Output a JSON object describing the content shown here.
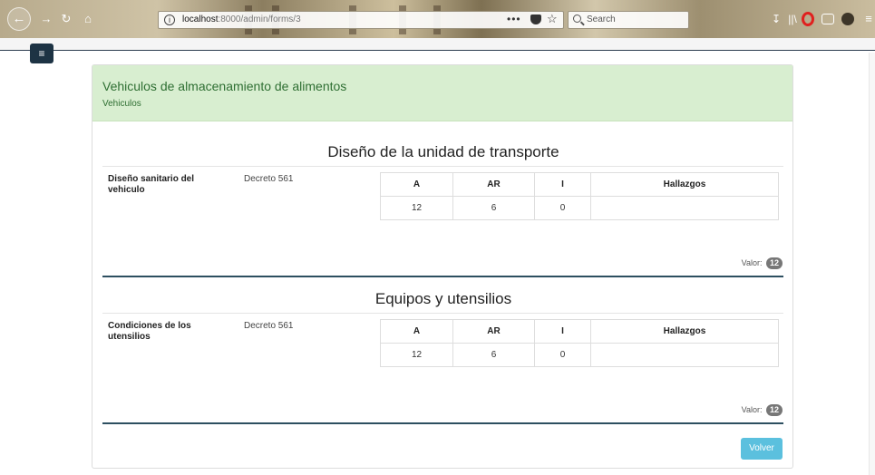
{
  "browser": {
    "url_host": "localhost",
    "url_path": ":8000/admin/forms/3",
    "search_placeholder": "Search",
    "more_label": "•••"
  },
  "header": {
    "title": "Vehiculos de almacenamiento de alimentos",
    "subtitle": "Vehiculos"
  },
  "table_headers": [
    "A",
    "AR",
    "I",
    "Hallazgos"
  ],
  "sections": [
    {
      "title": "Diseño de la unidad de transporte",
      "item_name": "Diseño sanitario del vehiculo",
      "norm": "Decreto 561",
      "values": [
        "12",
        "6",
        "0",
        ""
      ],
      "valor_label": "Valor:",
      "valor": "12"
    },
    {
      "title": "Equipos y utensilios",
      "item_name": "Condiciones de los utensilios",
      "norm": "Decreto 561",
      "values": [
        "12",
        "6",
        "0",
        ""
      ],
      "valor_label": "Valor:",
      "valor": "12"
    }
  ],
  "actions": {
    "volver_label": "Volver"
  },
  "colors": {
    "header_bg": "#d8eed0",
    "header_text": "#2f6f33",
    "button": "#5bc0de",
    "rule": "#2d4f60",
    "toggle": "#1d3344"
  }
}
